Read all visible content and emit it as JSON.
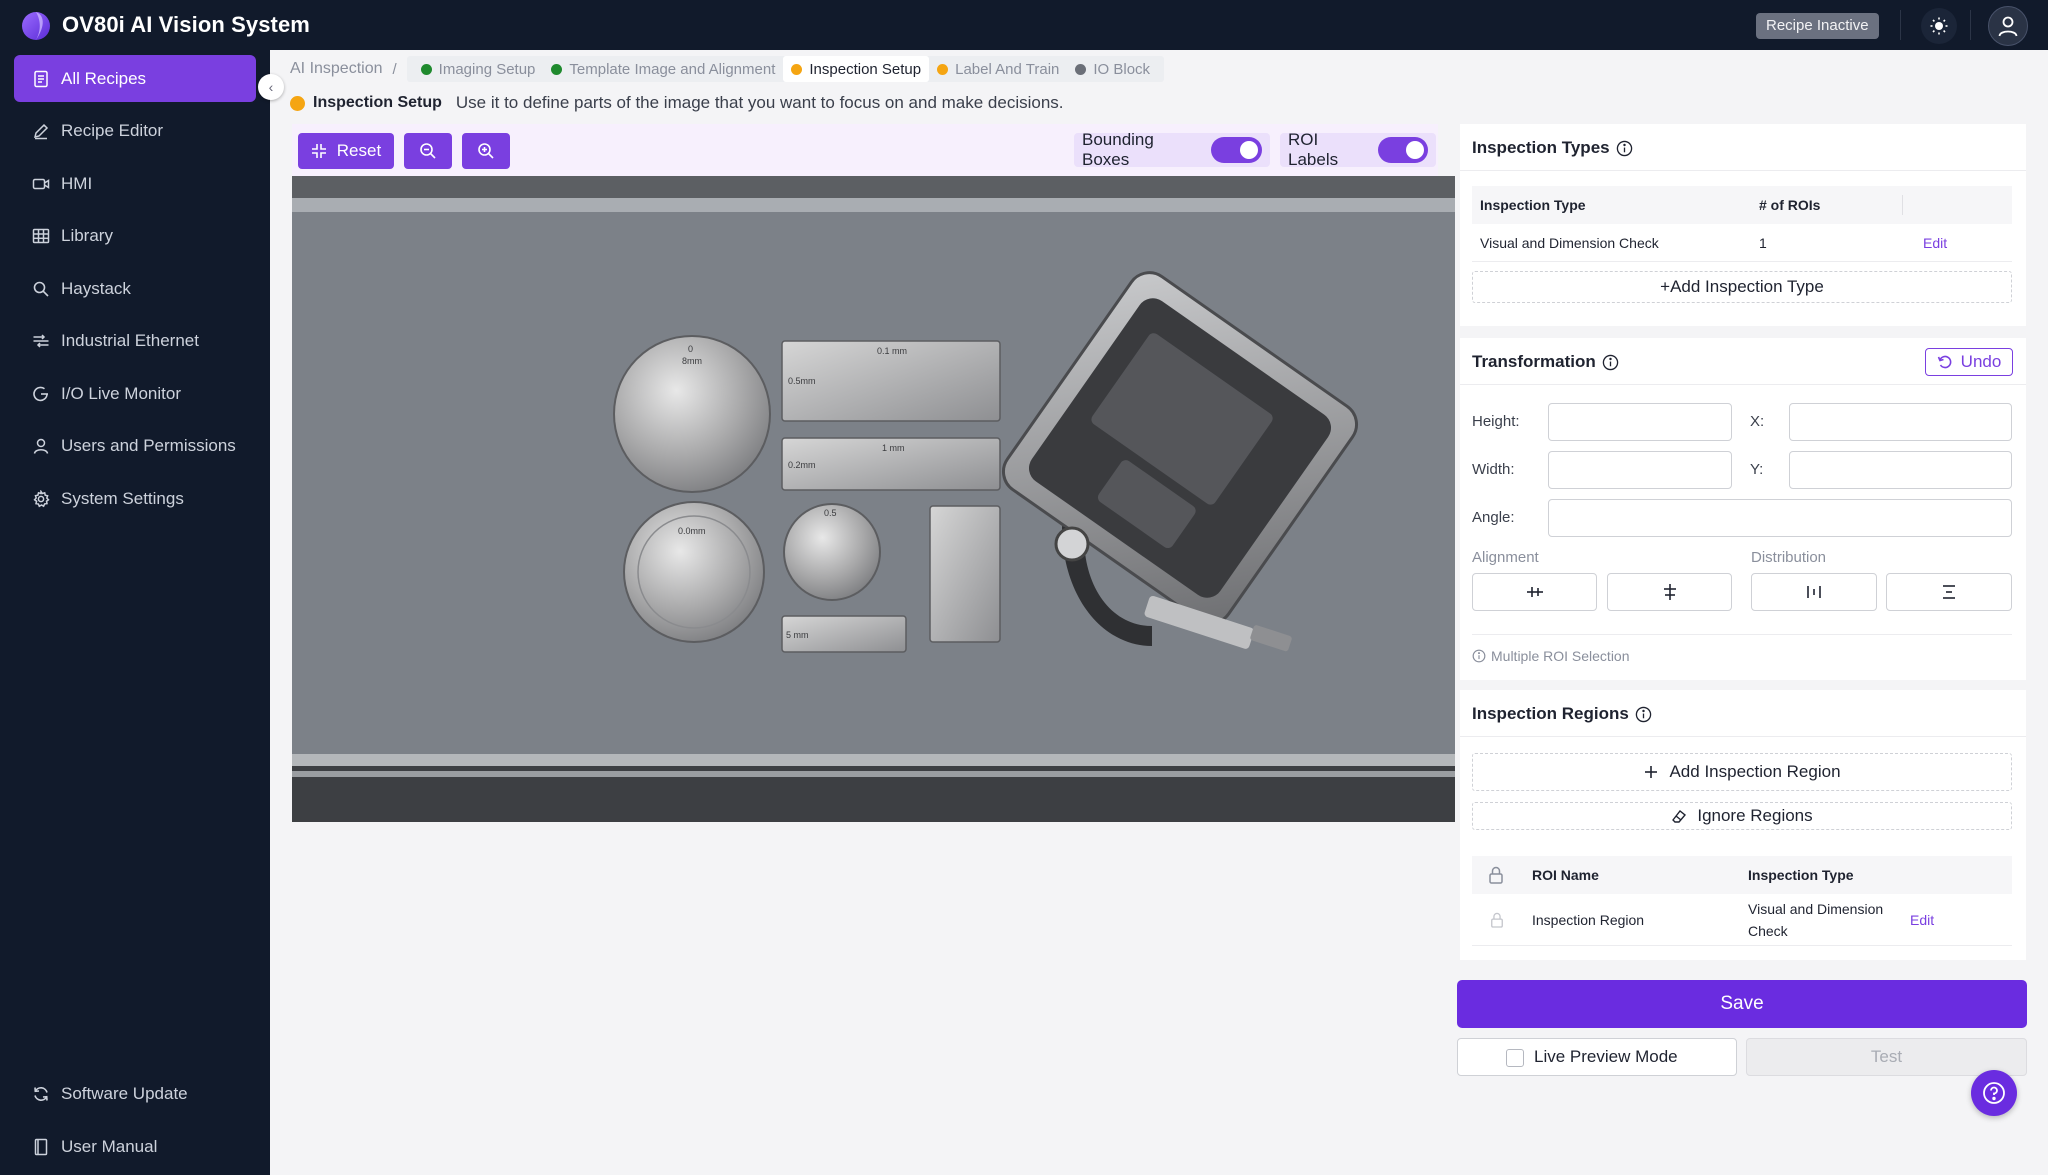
{
  "app": {
    "title": "OV80i AI Vision System",
    "status": "Recipe Inactive"
  },
  "sidebar": {
    "items": [
      {
        "label": "All Recipes",
        "icon": "document-icon",
        "active": true
      },
      {
        "label": "Recipe Editor",
        "icon": "pencil-icon"
      },
      {
        "label": "HMI",
        "icon": "video-icon"
      },
      {
        "label": "Library",
        "icon": "table-icon"
      },
      {
        "label": "Haystack",
        "icon": "search-icon"
      },
      {
        "label": "Industrial Ethernet",
        "icon": "network-icon"
      },
      {
        "label": "I/O Live Monitor",
        "icon": "monitor-icon"
      },
      {
        "label": "Users and Permissions",
        "icon": "user-icon"
      },
      {
        "label": "System Settings",
        "icon": "gear-icon"
      }
    ],
    "bottom": [
      {
        "label": "Software Update",
        "icon": "refresh-icon"
      },
      {
        "label": "User Manual",
        "icon": "book-icon"
      }
    ]
  },
  "breadcrumb": {
    "root": "AI Inspection",
    "separator": "/",
    "steps": [
      {
        "label": "Imaging Setup",
        "status_color": "#1f8a2e"
      },
      {
        "label": "Template Image and Alignment",
        "status_color": "#1f8a2e"
      },
      {
        "label": "Inspection Setup",
        "status_color": "#f5a512",
        "current": true
      },
      {
        "label": "Label And Train",
        "status_color": "#f5a512"
      },
      {
        "label": "IO Block",
        "status_color": "#6b6f78"
      }
    ]
  },
  "instruction": {
    "label": "Inspection Setup",
    "text": "Use it to define parts of the image that you want to focus on and make decisions."
  },
  "toolbar": {
    "reset_label": "Reset",
    "bounding_boxes_label": "Bounding Boxes",
    "bounding_boxes_on": true,
    "roi_labels_label": "ROI Labels",
    "roi_labels_on": true
  },
  "inspection_types": {
    "title": "Inspection Types",
    "headers": [
      "Inspection Type",
      "# of ROIs"
    ],
    "rows": [
      {
        "type": "Visual and Dimension Check",
        "rois": "1",
        "action": "Edit"
      }
    ],
    "add_label": "+Add Inspection Type"
  },
  "transformation": {
    "title": "Transformation",
    "undo_label": "Undo",
    "height_label": "Height:",
    "width_label": "Width:",
    "x_label": "X:",
    "y_label": "Y:",
    "angle_label": "Angle:",
    "alignment_label": "Alignment",
    "distribution_label": "Distribution",
    "multi_roi_label": "Multiple ROI Selection"
  },
  "inspection_regions": {
    "title": "Inspection Regions",
    "add_label": "Add Inspection Region",
    "ignore_label": "Ignore Regions",
    "headers": [
      "ROI Name",
      "Inspection Type"
    ],
    "rows": [
      {
        "name": "Inspection Region",
        "type_line1": "Visual and Dimension",
        "type_line2": "Check",
        "action": "Edit"
      }
    ]
  },
  "actions": {
    "save_label": "Save",
    "live_preview_label": "Live Preview Mode",
    "test_label": "Test"
  },
  "image_labels": {
    "disc1_top": "0",
    "disc1_bottom": "8mm",
    "block1_a": "0.1 mm",
    "block1_b": "0.5mm",
    "block2_a": "1 mm",
    "block2_b": "0.2mm",
    "disc2": "0.0mm",
    "disc3": "0.5",
    "block3": "5 mm"
  },
  "colors": {
    "accent": "#7a3fe0",
    "sidebar_bg": "#111a2b",
    "success": "#1f8a2e",
    "warning": "#f5a512"
  }
}
